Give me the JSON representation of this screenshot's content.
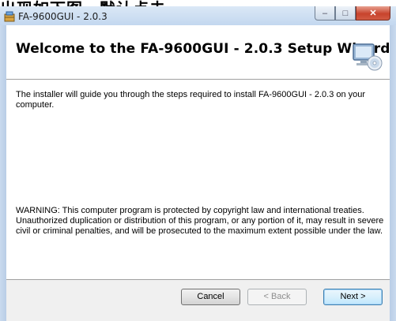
{
  "caption": {
    "text": "出现如下图，默认点击"
  },
  "window": {
    "title": "FA-9600GUI - 2.0.3",
    "controls": {
      "minimize": "–",
      "maximize": "□",
      "close": "✕"
    }
  },
  "header": {
    "title": "Welcome to the FA-9600GUI - 2.0.3 Setup Wizard"
  },
  "body": {
    "intro": "The installer will guide you through the steps required to install FA-9600GUI - 2.0.3 on your computer.",
    "warning": "WARNING: This computer program is protected by copyright law and international treaties. Unauthorized duplication or distribution of this program, or any portion of it, may result in severe civil or criminal penalties, and will be prosecuted to the maximum extent possible under the law."
  },
  "buttons": {
    "cancel": "Cancel",
    "back": "< Back",
    "next": "Next >"
  },
  "icons": {
    "app": "installer-box-icon",
    "header": "computer-cd-icon"
  },
  "colors": {
    "titlebar": "#c3d7ef",
    "close_button": "#c7442d",
    "default_button_border": "#3c7fb1"
  }
}
